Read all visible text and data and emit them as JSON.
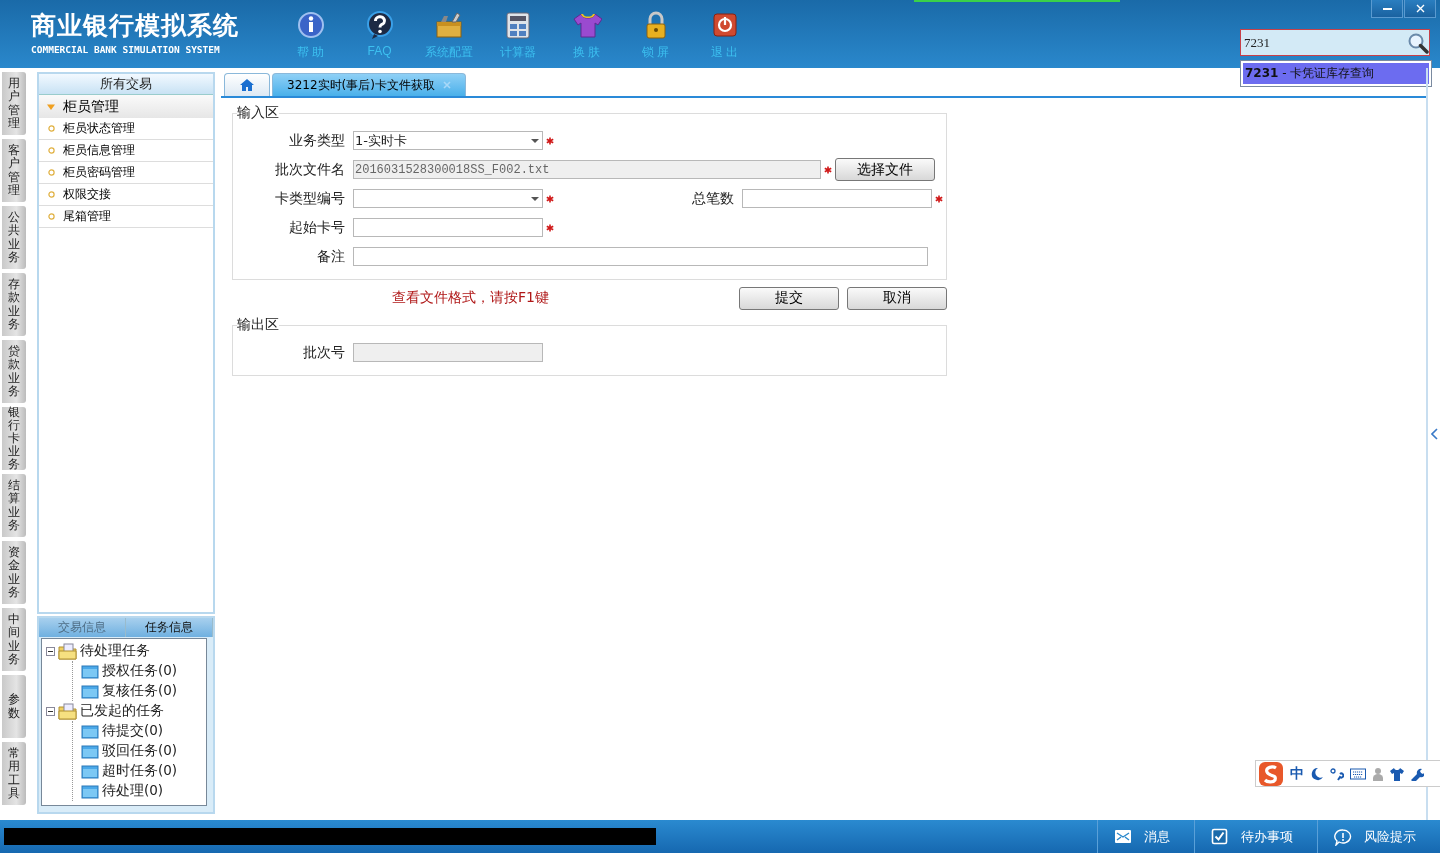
{
  "app": {
    "title": "商业银行模拟系统",
    "subtitle": "COMMERCIAL BANK SIMULATION SYSTEM"
  },
  "toolbar": [
    {
      "kind": "info",
      "label": "帮 助"
    },
    {
      "kind": "faq",
      "label": "FAQ"
    },
    {
      "kind": "config",
      "label": "系统配置"
    },
    {
      "kind": "calc",
      "label": "计算器"
    },
    {
      "kind": "skin",
      "label": "换 肤"
    },
    {
      "kind": "lock",
      "label": "锁 屏"
    },
    {
      "kind": "exit",
      "label": "退 出"
    }
  ],
  "search": {
    "value": "7231",
    "suggestions": [
      {
        "text": "**7231** - 卡凭证库存查询",
        "selected": true
      }
    ]
  },
  "side_tabs": [
    "用户管理",
    "客户管理",
    "公共业务",
    "存款业务",
    "贷款业务",
    "银行卡业务",
    "结算业务",
    "资金业务",
    "中间业务",
    "参数",
    "常用工具"
  ],
  "nav": {
    "header": "所有交易",
    "groups": [
      {
        "label": "柜员管理",
        "expanded": true,
        "children": [
          "柜员状态管理",
          "柜员信息管理",
          "柜员密码管理",
          "权限交接",
          "尾箱管理"
        ]
      }
    ]
  },
  "task_panel": {
    "tabs": [
      {
        "label": "交易信息",
        "selected": false
      },
      {
        "label": "任务信息",
        "selected": true
      }
    ],
    "tree": [
      {
        "label": "待处理任务",
        "expanded": true,
        "children": [
          {
            "label": "授权任务(0)"
          },
          {
            "label": "复核任务(0)"
          }
        ]
      },
      {
        "label": "已发起的任务",
        "expanded": true,
        "children": [
          {
            "label": "待提交(0)"
          },
          {
            "label": "驳回任务(0)"
          },
          {
            "label": "超时任务(0)"
          },
          {
            "label": "待处理(0)"
          }
        ]
      }
    ]
  },
  "doc_tabs": [
    {
      "kind": "home",
      "selected": false
    },
    {
      "kind": "doc",
      "label": "3212实时(事后)卡文件获取",
      "selected": true
    }
  ],
  "input_section": {
    "title": "输入区",
    "rows": [
      [
        {
          "label": "业务类型",
          "kind": "select",
          "value": "1-实时卡",
          "required": true,
          "disabled": false
        }
      ],
      [
        {
          "label": "批次文件名",
          "kind": "file",
          "value": "2016031528300018SS_F002.txt",
          "required": true,
          "disabled": true,
          "button": "选择文件"
        }
      ],
      [
        {
          "label": "卡类型编号",
          "kind": "select",
          "required": true,
          "disabled": false
        },
        {
          "label": "总笔数",
          "kind": "text",
          "required": true,
          "disabled": false
        }
      ],
      [
        {
          "label": "起始卡号",
          "kind": "text",
          "required": true,
          "disabled": false
        }
      ],
      [
        {
          "label": "备注",
          "kind": "wide",
          "required": false,
          "disabled": false
        }
      ]
    ]
  },
  "hint": "查看文件格式，请按F1键",
  "buttons": [
    "提交",
    "取消"
  ],
  "output_section": {
    "title": "输出区",
    "rows": [
      [
        {
          "label": "批次号",
          "kind": "text",
          "required": false,
          "disabled": true
        }
      ]
    ]
  },
  "ime": {
    "mode": "中"
  },
  "status_bar": [
    {
      "kind": "mail",
      "label": "消息"
    },
    {
      "kind": "check",
      "label": "待办事项"
    },
    {
      "kind": "chat",
      "label": "风险提示"
    }
  ]
}
